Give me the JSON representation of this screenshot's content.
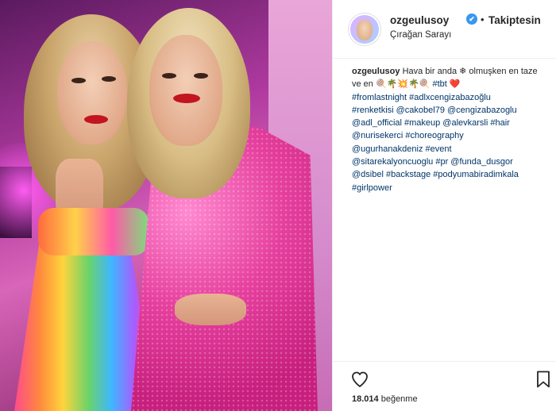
{
  "header": {
    "username": "ozgeulusoy",
    "verified_mark": "✔",
    "separator": "•",
    "follow_label": "Takiptesin",
    "location": "Çırağan Sarayı"
  },
  "caption": {
    "username": "ozgeulusoy",
    "text_1": " Hava bir anda ",
    "emoji_1": "❄",
    "text_2": " olmuşken en taze ve en ",
    "emoji_2": "🍭🌴💥🌴🍭",
    "tag_tbt": " #tbt",
    "emoji_heart": " ❤️",
    "lines": [
      "#fromlastnight #adlxcengizabazoğlu",
      "#renketkisi @cakobel79 @cengizabazoglu",
      "@adl_official #makeup @alevkarsli #hair",
      "@nurisekerci #choreography",
      "@ugurhanakdeniz #event",
      "@sitarekalyoncuoglu #pr @funda_dusgor",
      "@dsibel #backstage #podyumabiradimkala",
      "#girlpower"
    ]
  },
  "likes": {
    "count": "18.014",
    "label": " beğenme"
  },
  "icons": {
    "like": "heart-icon",
    "save": "bookmark-icon",
    "verified": "verified-badge-icon"
  },
  "colors": {
    "verified": "#3897f0",
    "tag": "#003569",
    "heart": "#ed4956"
  }
}
